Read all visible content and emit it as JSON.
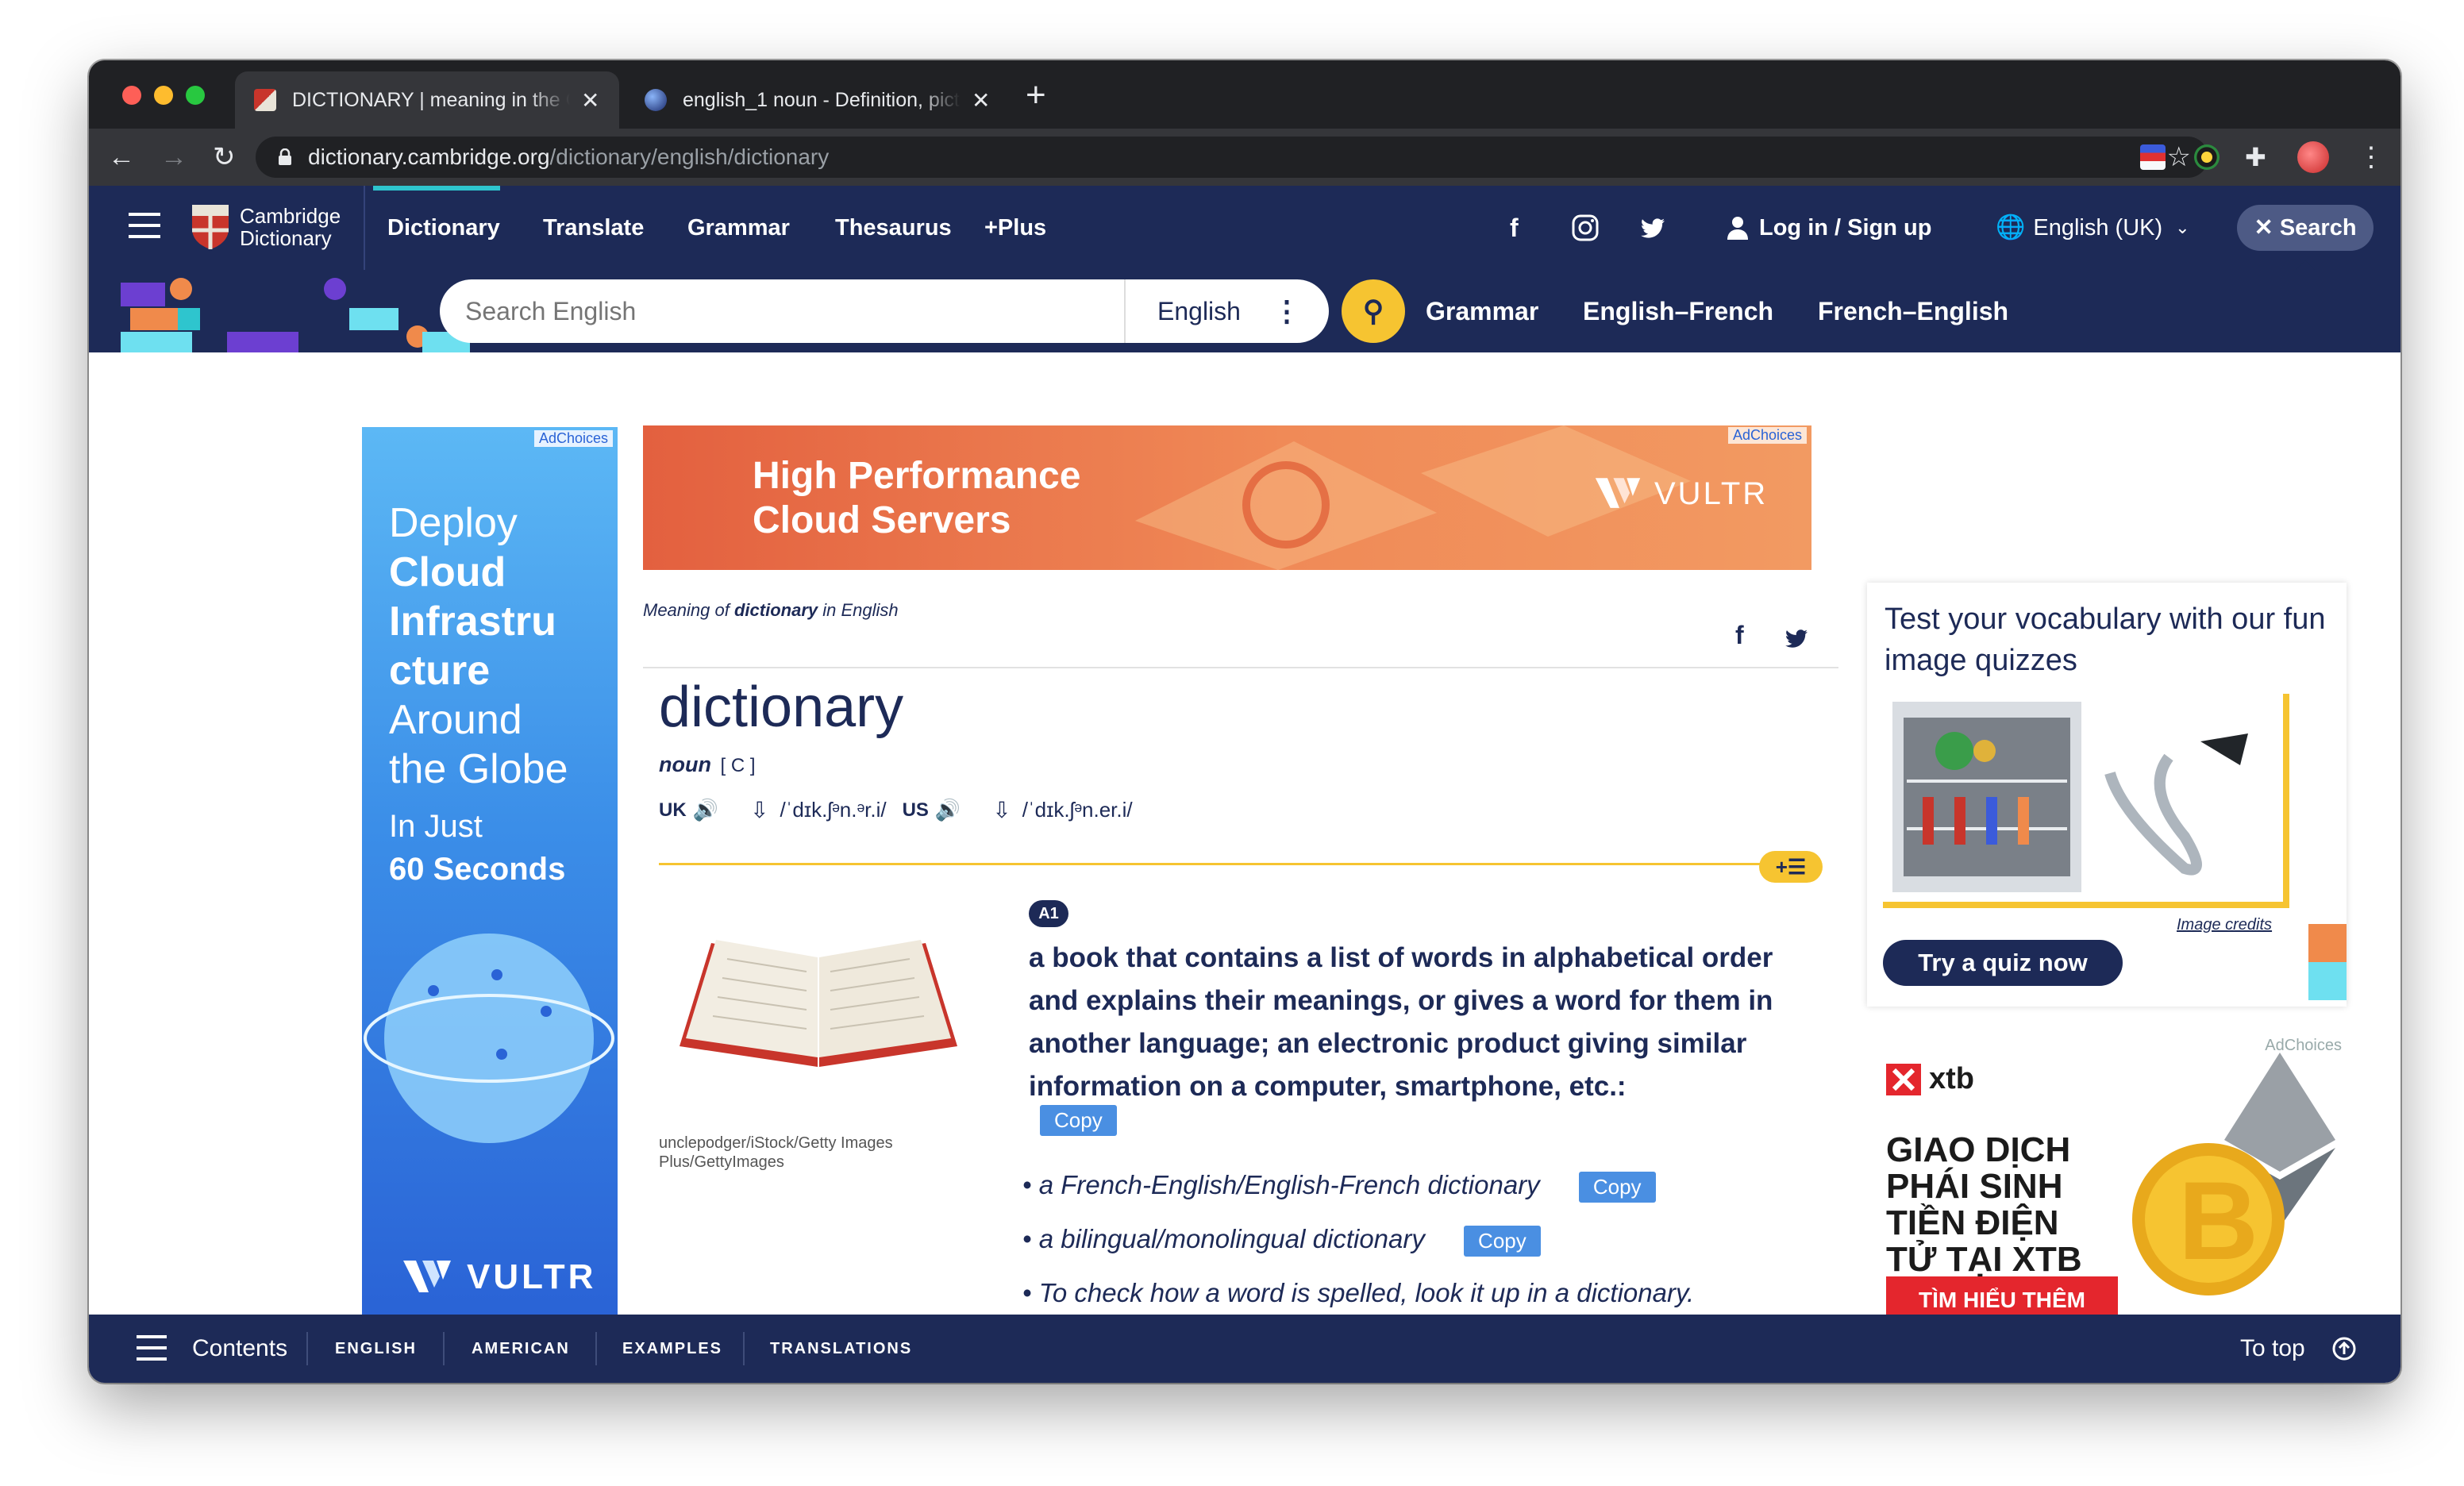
{
  "browser": {
    "tabs": [
      {
        "title": "DICTIONARY | meaning in the Cambridge English Dictionary",
        "active": true
      },
      {
        "title": "english_1 noun - Definition, pictures, pronunciation",
        "active": false
      }
    ],
    "url_host": "dictionary.cambridge.org",
    "url_path": "/dictionary/english/dictionary"
  },
  "site_nav": {
    "logo_line1": "Cambridge",
    "logo_line2": "Dictionary",
    "items": [
      "Dictionary",
      "Translate",
      "Grammar",
      "Thesaurus",
      "+Plus"
    ],
    "login": "Log in / Sign up",
    "language": "English (UK)",
    "search_button": "Search"
  },
  "search": {
    "placeholder": "Search English",
    "dictionary": "English",
    "links": [
      "Grammar",
      "English–French",
      "French–English"
    ]
  },
  "ads": {
    "left": {
      "adchoices": "AdChoices",
      "line1": "Deploy",
      "line2": "Cloud",
      "line3": "Infrastru",
      "line4": "cture",
      "line5": "Around",
      "line6": "the Globe",
      "line7": "In Just",
      "line8": "60 Seconds",
      "brand": "VULTR"
    },
    "top": {
      "adchoices": "AdChoices",
      "line1": "High Performance",
      "line2": "Cloud Servers",
      "brand": "VULTR"
    },
    "right": {
      "adchoices": "AdChoices",
      "brand": "xtb",
      "line1": "GIAO DỊCH",
      "line2": "PHÁI SINH",
      "line3": "TIỀN ĐIỆN",
      "line4": "TỬ TẠI XTB",
      "cta": "TÌM HIỂU THÊM"
    }
  },
  "entry": {
    "meaning_prefix": "Meaning of",
    "meaning_word": "dictionary",
    "meaning_suffix": "in English",
    "headword": "dictionary",
    "pos": "noun",
    "grammar": "[ C ]",
    "uk_label": "UK",
    "uk_ipa": "/ˈdɪk.ʃᵊn.ᵊr.i/",
    "us_label": "US",
    "us_ipa": "/ˈdɪk.ʃᵊn.er.i/",
    "level": "A1",
    "definition": "a book that contains a list of words in alphabetical order and explains their meanings, or gives a word for them in another language; an electronic product giving similar information on a computer, smartphone, etc.:",
    "image_credit": "unclepodger/iStock/Getty Images Plus/GettyImages",
    "copy_label": "Copy",
    "examples": [
      "a French-English/English-French dictionary",
      "a bilingual/monolingual dictionary",
      "To check how a word is spelled, look it up in a dictionary."
    ]
  },
  "quiz": {
    "title": "Test your vocabulary with our fun image quizzes",
    "credits": "Image credits",
    "button": "Try a quiz now"
  },
  "bottom": {
    "contents": "Contents",
    "sections": [
      "ENGLISH",
      "AMERICAN",
      "EXAMPLES",
      "TRANSLATIONS"
    ],
    "to_top": "To top"
  },
  "colors": {
    "navy": "#1d2a57",
    "yellow": "#f6c431",
    "copy_blue": "#4a8fe2",
    "chrome_dark": "#202124",
    "chrome_toolbar": "#35363a"
  }
}
